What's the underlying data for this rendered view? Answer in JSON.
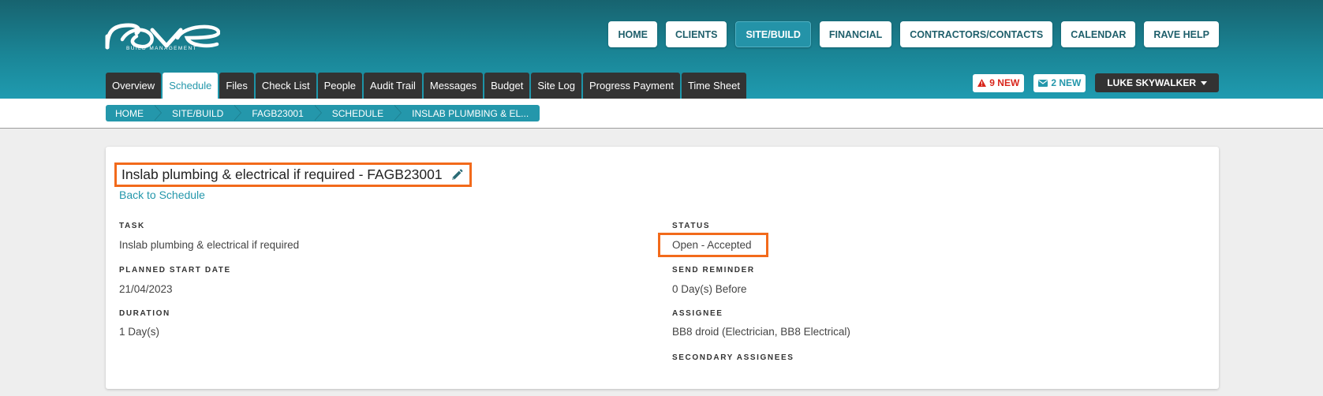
{
  "app": {
    "logo_text": "rave",
    "logo_subtitle": "BUILD MANAGEMENT"
  },
  "topnav": [
    {
      "label": "HOME",
      "active": false
    },
    {
      "label": "CLIENTS",
      "active": false
    },
    {
      "label": "SITE/BUILD",
      "active": true
    },
    {
      "label": "FINANCIAL",
      "active": false
    },
    {
      "label": "CONTRACTORS/CONTACTS",
      "active": false
    },
    {
      "label": "CALENDAR",
      "active": false
    },
    {
      "label": "RAVE HELP",
      "active": false
    }
  ],
  "tabs": [
    {
      "label": "Overview",
      "active": false
    },
    {
      "label": "Schedule",
      "active": true
    },
    {
      "label": "Files",
      "active": false
    },
    {
      "label": "Check List",
      "active": false
    },
    {
      "label": "People",
      "active": false
    },
    {
      "label": "Audit Trail",
      "active": false
    },
    {
      "label": "Messages",
      "active": false
    },
    {
      "label": "Budget",
      "active": false
    },
    {
      "label": "Site Log",
      "active": false
    },
    {
      "label": "Progress Payment",
      "active": false
    },
    {
      "label": "Time Sheet",
      "active": false
    }
  ],
  "alerts": {
    "warnings_label": "9 NEW",
    "messages_label": "2 NEW",
    "user_name": "LUKE SKYWALKER"
  },
  "breadcrumb": [
    "HOME",
    "SITE/BUILD",
    "FAGB23001",
    "SCHEDULE",
    "INSLAB PLUMBING & EL..."
  ],
  "task": {
    "title": "Inslab plumbing & electrical if required - FAGB23001",
    "back_link": "Back to Schedule",
    "task_label": "TASK",
    "task_value": "Inslab plumbing & electrical if required",
    "start_label": "PLANNED START DATE",
    "start_value": "21/04/2023",
    "duration_label": "DURATION",
    "duration_value": "1 Day(s)",
    "status_label": "STATUS",
    "status_value": "Open - Accepted",
    "reminder_label": "SEND REMINDER",
    "reminder_value": "0 Day(s) Before",
    "assignee_label": "ASSIGNEE",
    "assignee_value": "BB8 droid (Electrician, BB8 Electrical)",
    "secondary_label": "SECONDARY ASSIGNEES"
  },
  "colors": {
    "accent": "#2497ab",
    "highlight": "#f26a1b",
    "alert_red": "#d9261c",
    "dark_tab": "#333333"
  },
  "icons": {
    "title_edit": "pencil-icon",
    "warnings": "warning-triangle-icon",
    "messages": "envelope-icon",
    "user_menu": "caret-down-icon"
  }
}
